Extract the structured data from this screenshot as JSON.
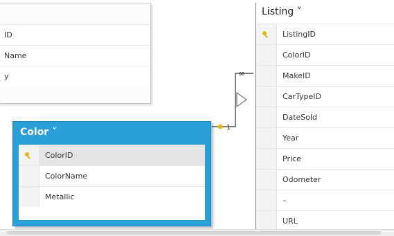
{
  "tables": {
    "upper_left": {
      "fields": [
        {
          "label": "ID"
        },
        {
          "label": "Name"
        },
        {
          "label": "y"
        }
      ]
    },
    "listing": {
      "title": "Listing ˅",
      "fields": [
        {
          "label": "ListingID",
          "is_key": true
        },
        {
          "label": "ColorID"
        },
        {
          "label": "MakeID"
        },
        {
          "label": "CarTypeID"
        },
        {
          "label": "DateSold"
        },
        {
          "label": "Year"
        },
        {
          "label": "Price"
        },
        {
          "label": "Odometer"
        },
        {
          "label": "–"
        },
        {
          "label": "URL"
        }
      ]
    },
    "color": {
      "title": "Color ˅",
      "fields": [
        {
          "label": "ColorID",
          "is_key": true
        },
        {
          "label": "ColorName"
        },
        {
          "label": "Metallic"
        }
      ]
    }
  },
  "relationship": {
    "many_side_symbol": "∞",
    "one_side_symbol": "1"
  },
  "colors": {
    "selected_table": "#2a9fd8",
    "key_icon": "#e0b81d",
    "relationship_line": "#555555"
  },
  "icons": [
    "key-icon",
    "expand-chevron-icon",
    "filter-direction-arrow-icon"
  ]
}
